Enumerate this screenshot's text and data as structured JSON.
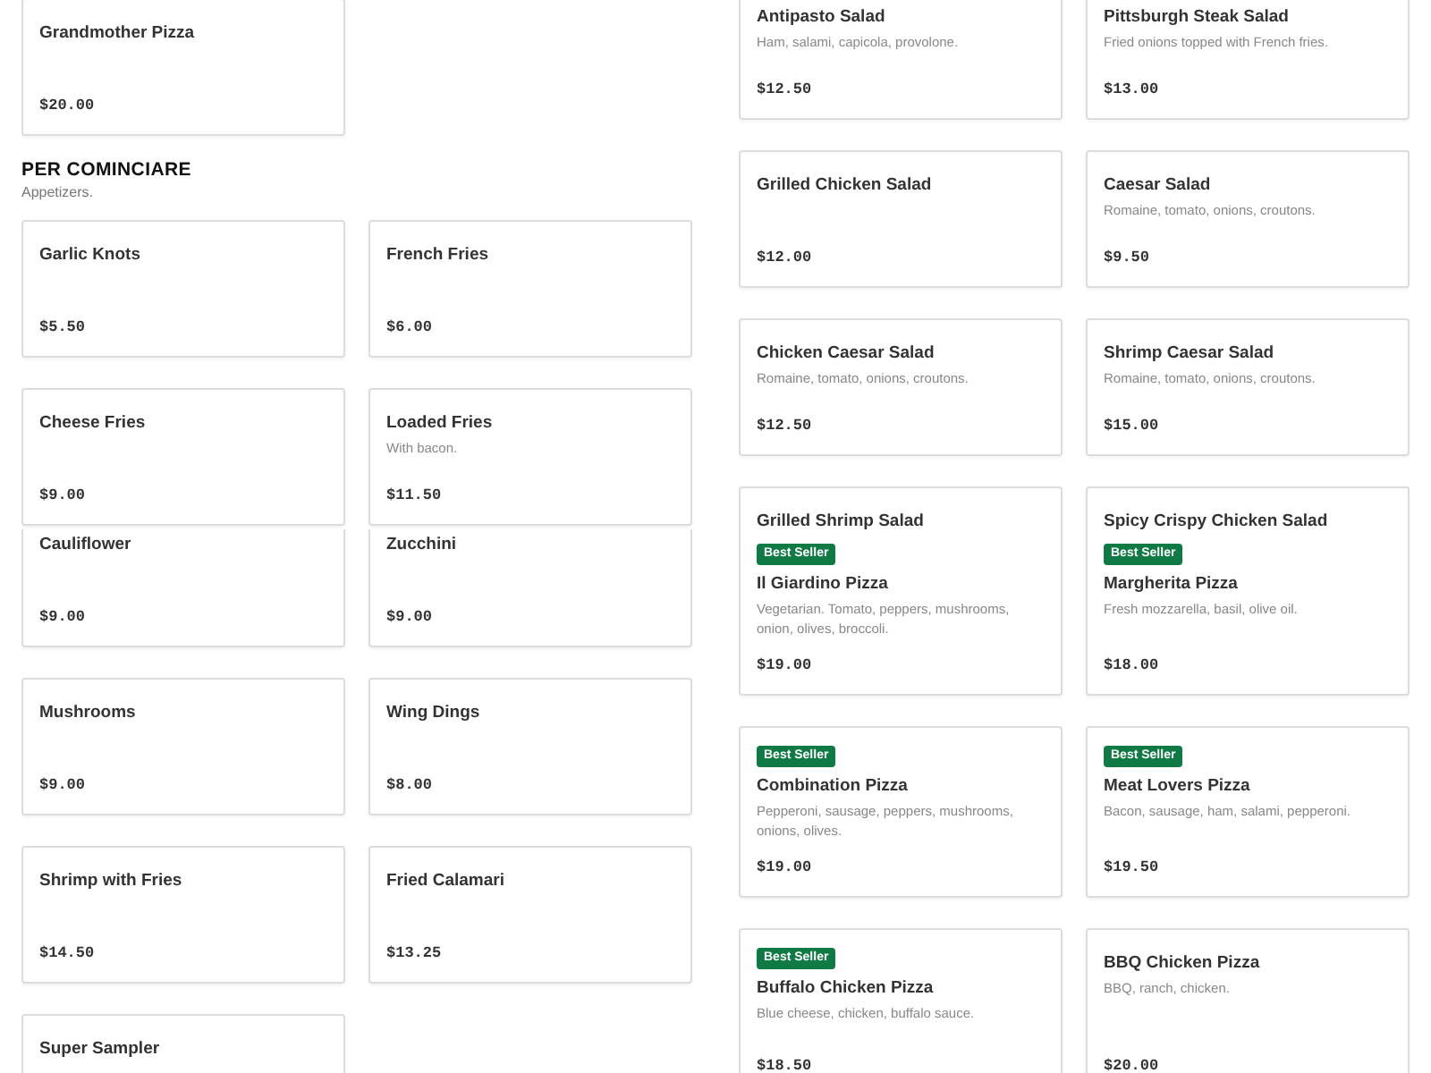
{
  "columns": [
    {
      "panels": [
        {
          "blocks": [
            {
              "kind": "cards",
              "cards": [
                {
                  "name": "Grandmother Pizza",
                  "price": "$20.00"
                }
              ]
            },
            {
              "kind": "heading",
              "title": "PER COMINCIARE",
              "subtitle": "Appetizers."
            },
            {
              "kind": "cards",
              "cards": [
                {
                  "name": "Garlic Knots",
                  "price": "$5.50"
                },
                {
                  "name": "French Fries",
                  "price": "$6.00"
                },
                {
                  "name": "Cheese Fries",
                  "price": "$9.00"
                },
                {
                  "name": "Loaded Fries",
                  "description": "With bacon.",
                  "price": "$11.50"
                }
              ]
            }
          ]
        },
        {
          "blocks": [
            {
              "kind": "cards",
              "cards": [
                {
                  "name": "Cauliflower",
                  "price": "$9.00"
                },
                {
                  "name": "Zucchini",
                  "price": "$9.00"
                },
                {
                  "name": "Mushrooms",
                  "price": "$9.00"
                },
                {
                  "name": "Wing Dings",
                  "price": "$8.00"
                },
                {
                  "name": "Shrimp with Fries",
                  "price": "$14.50"
                },
                {
                  "name": "Fried Calamari",
                  "price": "$13.25"
                },
                {
                  "name": "Super Sampler"
                }
              ]
            }
          ]
        }
      ]
    },
    {
      "panels": [
        {
          "blocks": [
            {
              "kind": "cards",
              "cards": [
                {
                  "name": "Antipasto Salad",
                  "description": "Ham, salami, capicola, provolone.",
                  "price": "$12.50"
                },
                {
                  "name": "Pittsburgh Steak Salad",
                  "description": "Fried onions topped with French fries.",
                  "price": "$13.00"
                },
                {
                  "name": "Grilled Chicken Salad",
                  "price": "$12.00"
                },
                {
                  "name": "Caesar Salad",
                  "description": "Romaine, tomato, onions, croutons.",
                  "price": "$9.50"
                },
                {
                  "name": "Chicken Caesar Salad",
                  "description": "Romaine, tomato, onions, croutons.",
                  "price": "$12.50"
                },
                {
                  "name": "Shrimp Caesar Salad",
                  "description": "Romaine, tomato, onions, croutons.",
                  "price": "$15.00"
                },
                {
                  "name": "Grilled Shrimp Salad"
                },
                {
                  "name": "Spicy Crispy Chicken Salad"
                }
              ]
            }
          ]
        },
        {
          "blocks": [
            {
              "kind": "cards",
              "cards": [
                {
                  "badge": "Best Seller",
                  "name": "Il Giardino Pizza",
                  "description": "Vegetarian. Tomato, peppers, mushrooms, onion, olives, broccoli.",
                  "price": "$19.00"
                },
                {
                  "badge": "Best Seller",
                  "name": "Margherita Pizza",
                  "description": "Fresh mozzarella, basil, olive oil.",
                  "price": "$18.00"
                },
                {
                  "badge": "Best Seller",
                  "name": "Combination Pizza",
                  "description": "Pepperoni, sausage, peppers, mushrooms, onions, olives.",
                  "price": "$19.00"
                },
                {
                  "badge": "Best Seller",
                  "name": "Meat Lovers Pizza",
                  "description": "Bacon, sausage, ham, salami, pepperoni.",
                  "price": "$19.50"
                },
                {
                  "badge": "Best Seller",
                  "name": "Buffalo Chicken Pizza",
                  "description": "Blue cheese, chicken, buffalo sauce.",
                  "price": "$18.50"
                },
                {
                  "name": "BBQ Chicken Pizza",
                  "description": "BBQ, ranch, chicken.",
                  "price": "$20.00"
                }
              ]
            }
          ]
        }
      ]
    }
  ]
}
